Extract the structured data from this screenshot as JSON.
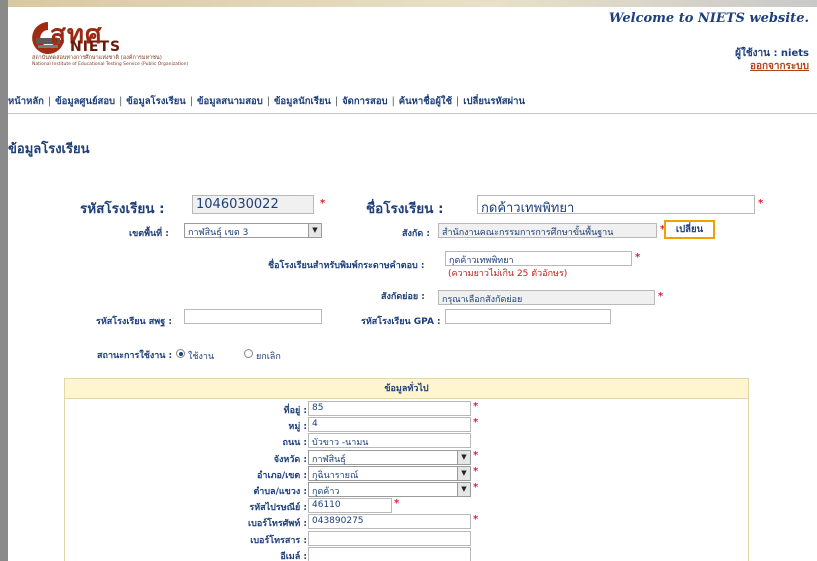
{
  "header": {
    "welcome": "Welcome to NIETS website.",
    "user_label": "ผู้ใช้งาน : niets",
    "logout": "ออกจากระบบ",
    "logo_thai": "สทศ",
    "logo_en": "NIETS",
    "logo_sub_th": "สถาบันทดสอบทางการศึกษาแห่งชาติ (องค์การมหาชน)",
    "logo_sub_en": "National Institute of Educational Testing Service (Public Organization)"
  },
  "nav": [
    "หน้าหลัก",
    "ข้อมูลศูนย์สอบ",
    "ข้อมูลโรงเรียน",
    "ข้อมูลสนามสอบ",
    "ข้อมูลนักเรียน",
    "จัดการสอบ",
    "ค้นหาชื่อผู้ใช้",
    "เปลี่ยนรหัสผ่าน"
  ],
  "nav_sep": "|",
  "page_title": "ข้อมูลโรงเรียน",
  "form": {
    "school_code_label": "รหัสโรงเรียน :",
    "school_code": "1046030022",
    "school_name_label": "ชื่อโรงเรียน :",
    "school_name": "กุดค้าวเทพพิทยา",
    "area_label": "เขตพื้นที่ :",
    "area_value": "กาฬสินธุ์ เขต 3",
    "affiliation_label": "สังกัด :",
    "affiliation_value": "สำนักงานคณะกรรมการการศึกษาขั้นพื้นฐาน",
    "change_button": "เปลี่ยน",
    "print_name_label": "ชื่อโรงเรียนสำหรับพิมพ์กระดาษคำตอบ :",
    "print_name_value": "กุดค้าวเทพพิทยา",
    "print_name_note": "(ความยาวไม่เกิน 25 ตัวอักษร)",
    "sub_affiliation_label": "สังกัดย่อย :",
    "sub_affiliation_value": "กรุณาเลือกสังกัดย่อย",
    "obec_code_label": "รหัสโรงเรียน สพฐ :",
    "obec_code_value": "",
    "gpa_code_label": "รหัสโรงเรียน GPA :",
    "gpa_code_value": "",
    "status_label": "สถานะการใช้งาน :",
    "status_active": "ใช้งาน",
    "status_cancel": "ยกเลิก",
    "required_mark": "*"
  },
  "general": {
    "title": "ข้อมูลทั่วไป",
    "fields": [
      {
        "label": "ที่อยู่ :",
        "value": "85",
        "type": "text",
        "required": true
      },
      {
        "label": "หมู่ :",
        "value": "4",
        "type": "text",
        "required": true
      },
      {
        "label": "ถนน :",
        "value": "บัวขาว -นามน",
        "type": "text",
        "required": false
      },
      {
        "label": "จังหวัด :",
        "value": "กาฬสินธุ์",
        "type": "select",
        "required": true
      },
      {
        "label": "อำเภอ/เขต :",
        "value": "กุฉินารายณ์",
        "type": "select",
        "required": true
      },
      {
        "label": "ตำบล/แขวง :",
        "value": "กุดค้าว",
        "type": "select",
        "required": true
      },
      {
        "label": "รหัสไปรษณีย์ :",
        "value": "46110",
        "type": "text",
        "required": true
      },
      {
        "label": "เบอร์โทรศัพท์ :",
        "value": "043890275",
        "type": "text",
        "required": true
      },
      {
        "label": "เบอร์โทรสาร :",
        "value": "",
        "type": "text",
        "required": false
      },
      {
        "label": "อีเมล์ :",
        "value": "",
        "type": "text",
        "required": false
      }
    ]
  }
}
